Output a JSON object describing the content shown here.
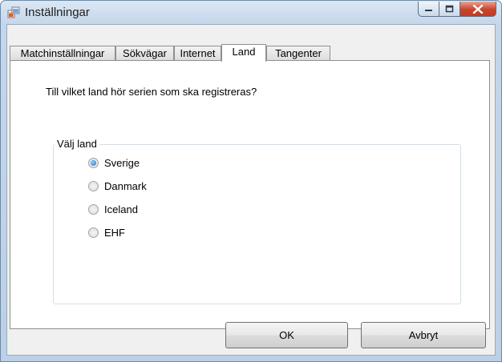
{
  "window": {
    "title": "Inställningar"
  },
  "tabs": [
    {
      "label": "Matchinställningar",
      "active": false
    },
    {
      "label": "Sökvägar",
      "active": false
    },
    {
      "label": "Internet",
      "active": false
    },
    {
      "label": "Land",
      "active": true
    },
    {
      "label": "Tangenter",
      "active": false
    }
  ],
  "land_tab": {
    "question": "Till vilket land hör serien som ska registreras?",
    "group_label": "Välj land",
    "options": [
      {
        "label": "Sverige",
        "checked": true
      },
      {
        "label": "Danmark",
        "checked": false
      },
      {
        "label": "Iceland",
        "checked": false
      },
      {
        "label": "EHF",
        "checked": false
      }
    ]
  },
  "buttons": {
    "ok": "OK",
    "cancel": "Avbryt"
  },
  "icons": [
    "window-app-icon",
    "minimize-icon",
    "maximize-icon",
    "close-icon",
    "radio-icon"
  ],
  "colors": {
    "close_button": "#c8442b",
    "radio_selected": "#1b6bc2"
  }
}
